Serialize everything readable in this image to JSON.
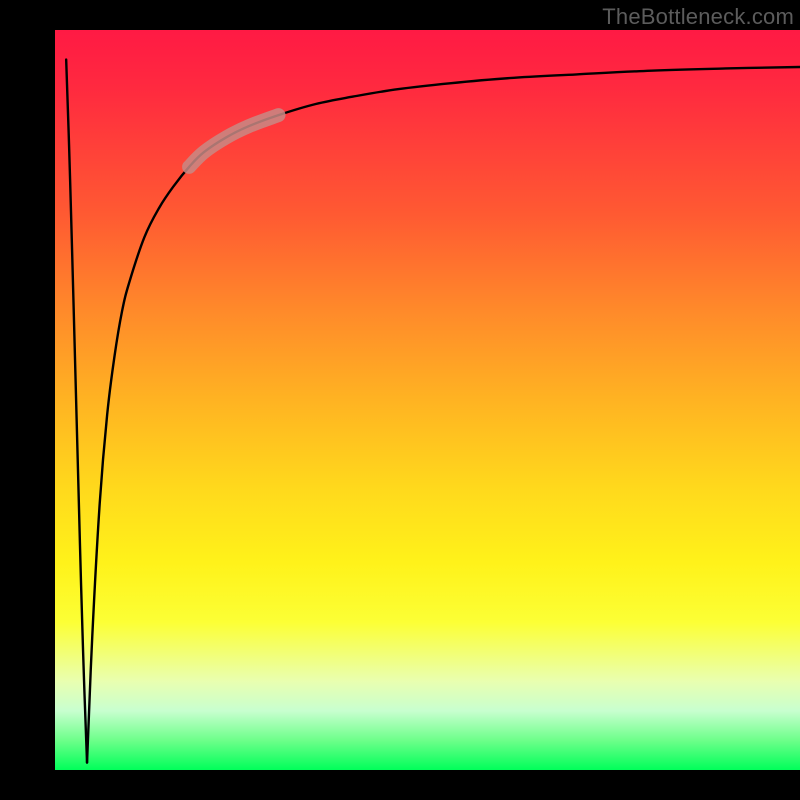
{
  "watermark": "TheBottleneck.com",
  "colors": {
    "background": "#000000",
    "curve": "#000000",
    "highlight": "#c88a85",
    "gradient_top": "#ff1a44",
    "gradient_bottom": "#00ff5a"
  },
  "chart_data": {
    "type": "line",
    "title": "",
    "xlabel": "",
    "ylabel": "",
    "xlim": [
      0,
      100
    ],
    "ylim": [
      0,
      100
    ],
    "grid": false,
    "legend": false,
    "annotations": [
      {
        "name": "highlight-segment",
        "x_range": [
          19,
          30
        ],
        "note": "thick faded stroke over curve"
      }
    ],
    "series": [
      {
        "name": "descending-branch",
        "x": [
          1.5,
          1.9,
          2.3,
          2.7,
          3.1,
          3.5,
          3.9,
          4.3
        ],
        "values": [
          96,
          84,
          70,
          55,
          40,
          25,
          12,
          1
        ]
      },
      {
        "name": "ascending-log-branch",
        "x": [
          4.3,
          5,
          6,
          7,
          8,
          9,
          10,
          12,
          14,
          16,
          18,
          20,
          23,
          26,
          30,
          35,
          40,
          46,
          53,
          61,
          70,
          80,
          90,
          100
        ],
        "values": [
          1,
          18,
          36,
          48,
          56,
          62,
          66,
          72,
          76,
          79,
          81.5,
          83.5,
          85.5,
          87,
          88.5,
          90,
          91,
          92,
          92.8,
          93.5,
          94,
          94.5,
          94.8,
          95
        ]
      }
    ]
  }
}
